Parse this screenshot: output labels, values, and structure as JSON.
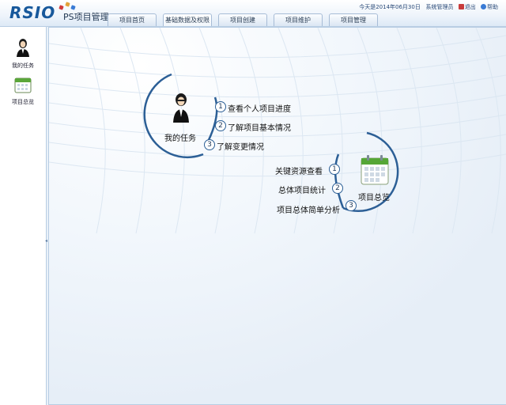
{
  "header": {
    "logo_text": "RSIO",
    "app_title": "PS项目管理",
    "tabs": [
      {
        "label": "项目首页"
      },
      {
        "label": "基础数据及权限"
      },
      {
        "label": "项目创建"
      },
      {
        "label": "项目维护"
      },
      {
        "label": "项目管理"
      }
    ],
    "date_text": "今天是2014年06月30日",
    "user": "系统管理员",
    "logout": "退出",
    "help": "帮助"
  },
  "sidebar": {
    "items": [
      {
        "label": "我的任务",
        "icon": "person-icon"
      },
      {
        "label": "项目总览",
        "icon": "calendar-icon"
      }
    ]
  },
  "main": {
    "task_hub": {
      "label": "我的任务",
      "items": [
        {
          "num": "1",
          "label": "查看个人项目进度"
        },
        {
          "num": "2",
          "label": "了解项目基本情况"
        },
        {
          "num": "3",
          "label": "了解变更情况"
        }
      ]
    },
    "overview_hub": {
      "label": "项目总览",
      "items": [
        {
          "num": "1",
          "label": "关键资源查看"
        },
        {
          "num": "2",
          "label": "总体项目统计"
        },
        {
          "num": "3",
          "label": "项目总体简单分析"
        }
      ]
    }
  },
  "colors": {
    "brand": "#17589b",
    "arc": "#2c5f96",
    "background": "#eef4fa"
  }
}
